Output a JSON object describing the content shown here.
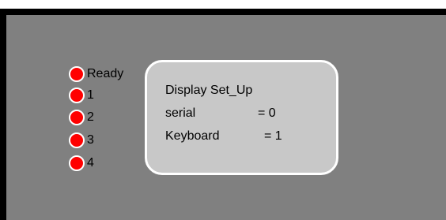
{
  "colors": {
    "frame": "#000000",
    "screen": "#808080",
    "panel": "#c8c8c8",
    "panel_border": "#ffffff",
    "led_on": "#ff0000",
    "led_border": "#ffffff"
  },
  "indicators": [
    {
      "label": "Ready",
      "state": "red",
      "icon": "led-icon"
    },
    {
      "label": "1",
      "state": "red",
      "icon": "led-icon"
    },
    {
      "label": "2",
      "state": "red",
      "icon": "led-icon"
    },
    {
      "label": "3",
      "state": "red",
      "icon": "led-icon"
    },
    {
      "label": "4",
      "state": "red",
      "icon": "led-icon"
    }
  ],
  "display_panel": {
    "title": "Display Set_Up",
    "rows": [
      {
        "key": "serial",
        "value": "= 0"
      },
      {
        "key": "Keyboard",
        "value": "= 1"
      }
    ]
  }
}
